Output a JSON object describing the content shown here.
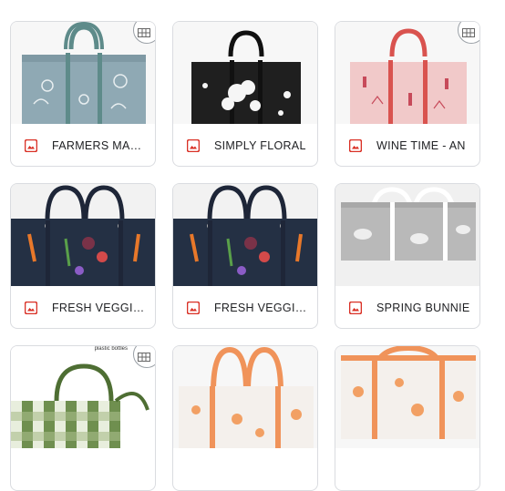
{
  "files": [
    {
      "name": "FARMERS MARKET",
      "pattern": "farmers-market",
      "base": "#8fa9b4",
      "strap": "#5e8b8a"
    },
    {
      "name": "SIMPLY FLORAL",
      "pattern": "simply-floral",
      "base": "#1f1f1f",
      "strap": "#1a1a1a"
    },
    {
      "name": "WINE TIME - AN",
      "pattern": "wine-time",
      "base": "#f1c9c9",
      "strap": "#d9534f"
    },
    {
      "name": "FRESH VEGGIES",
      "pattern": "fresh-veggies",
      "base": "#243044",
      "strap": "#1e2638"
    },
    {
      "name": "FRESH VEGGIES",
      "pattern": "fresh-veggies",
      "base": "#243044",
      "strap": "#1e2638"
    },
    {
      "name": "SPRING BUNNIE",
      "pattern": "spring-bunnies",
      "base": "#b9b9b9",
      "strap": "#ffffff"
    },
    {
      "name": "",
      "pattern": "green-gingham",
      "base": "#6f8f4f",
      "strap": "#5d7d3f"
    },
    {
      "name": "",
      "pattern": "peach-floral",
      "base": "#f4f0ec",
      "strap": "#f0935a"
    },
    {
      "name": "",
      "pattern": "peach-floral",
      "base": "#f4f0ec",
      "strap": "#f0935a"
    }
  ],
  "photo_caption": "plastic bottles",
  "colors": {
    "file_icon": "#d93025",
    "border": "#dadce0"
  }
}
